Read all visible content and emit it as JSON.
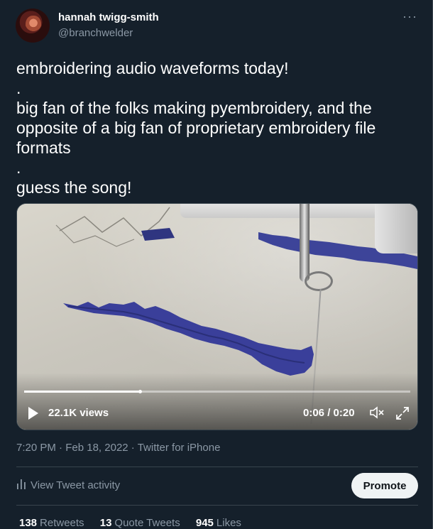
{
  "author": {
    "display_name": "hannah twigg-smith",
    "username": "@branchwelder"
  },
  "header": {
    "more_icon": "more-icon"
  },
  "tweet": {
    "lines": [
      "embroidering audio waveforms today!",
      ".",
      "big fan of the folks making pyembroidery, and the opposite of a big fan of proprietary embroidery file formats",
      ".",
      "guess the song!"
    ]
  },
  "video": {
    "views": "22.1K views",
    "time": "0:06 / 0:20",
    "progress": 0.3,
    "play_icon": "play-icon",
    "mute_icon": "mute-icon",
    "fullscreen_icon": "fullscreen-icon"
  },
  "meta": {
    "time": "7:20 PM",
    "date": "Feb 18, 2022",
    "source": "Twitter for iPhone",
    "separator": " · "
  },
  "activity": {
    "label": "View Tweet activity",
    "icon": "bar-chart-icon",
    "promote_label": "Promote"
  },
  "stats": {
    "retweets_count": "138",
    "retweets_label": "Retweets",
    "quotes_count": "13",
    "quotes_label": "Quote Tweets",
    "likes_count": "945",
    "likes_label": "Likes"
  },
  "colors": {
    "background": "#15202b",
    "secondary_text": "#8b98a5",
    "thread_blue": "#3a3f9a"
  }
}
